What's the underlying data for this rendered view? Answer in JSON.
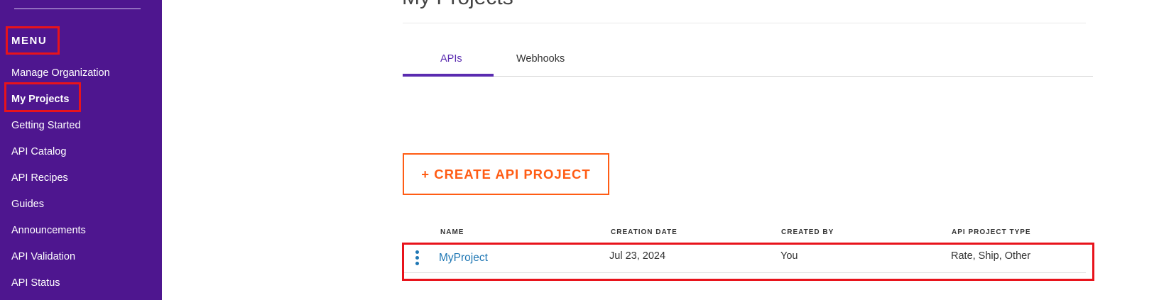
{
  "sidebar": {
    "menu_heading": "MENU",
    "items": [
      {
        "label": "Manage Organization"
      },
      {
        "label": "My Projects"
      },
      {
        "label": "Getting Started"
      },
      {
        "label": "API Catalog"
      },
      {
        "label": "API Recipes"
      },
      {
        "label": "Guides"
      },
      {
        "label": "Announcements"
      },
      {
        "label": "API Validation"
      },
      {
        "label": "API Status"
      }
    ]
  },
  "page": {
    "title": "My Projects"
  },
  "tabs": [
    {
      "label": "APIs",
      "active": true
    },
    {
      "label": "Webhooks",
      "active": false
    }
  ],
  "create_button": {
    "label": "+ CREATE API PROJECT"
  },
  "table": {
    "columns": [
      "NAME",
      "CREATION DATE",
      "CREATED BY",
      "API PROJECT TYPE"
    ],
    "rows": [
      {
        "name": "MyProject",
        "creation_date": "Jul 23, 2024",
        "created_by": "You",
        "type": "Rate, Ship, Other"
      }
    ]
  },
  "colors": {
    "sidebar_bg": "#4e168f",
    "accent_purple": "#5a2bb0",
    "accent_orange": "#ff5c14",
    "link_blue": "#1f77b4",
    "highlight_red": "#e8131b"
  },
  "icons": {
    "row_menu": "kebab-menu-icon"
  }
}
